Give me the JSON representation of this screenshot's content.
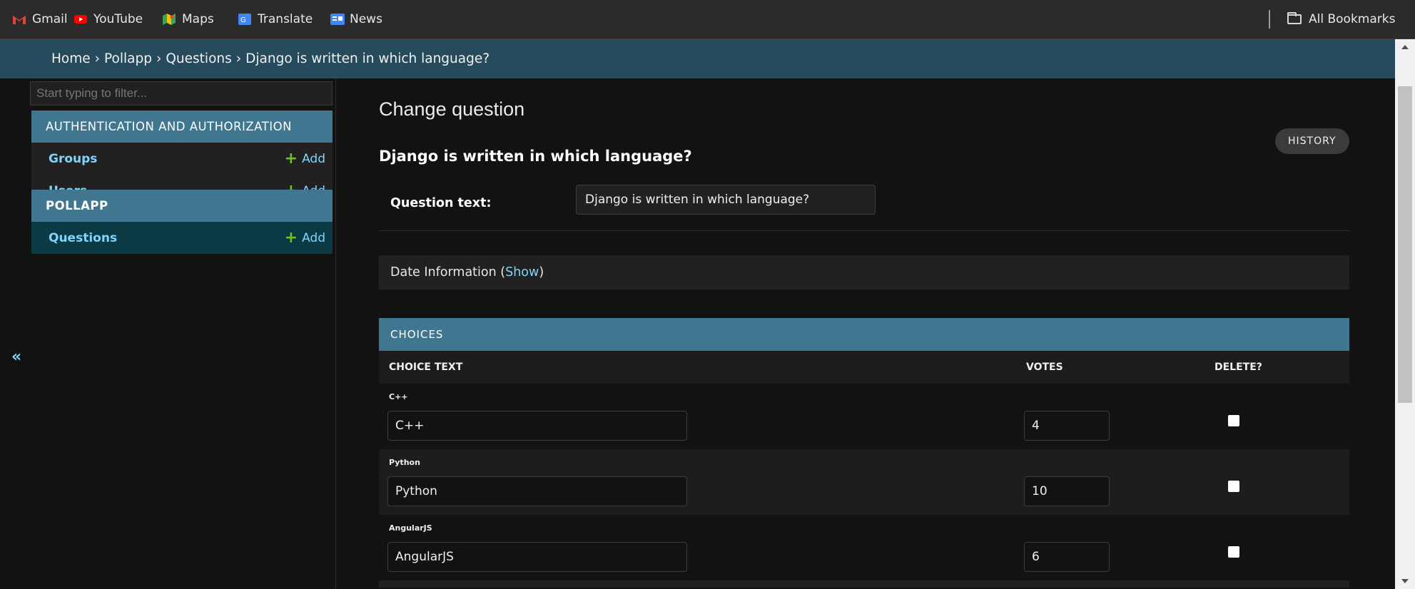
{
  "bookmarks": {
    "items": [
      {
        "label": "Gmail",
        "color": "#ea4335"
      },
      {
        "label": "YouTube",
        "color": "#ff0000"
      },
      {
        "label": "Maps",
        "color": "#34a853"
      },
      {
        "label": "Translate",
        "color": "#4285f4"
      },
      {
        "label": "News",
        "color": "#4285f4"
      }
    ],
    "all_bookmarks": "All Bookmarks"
  },
  "breadcrumb": {
    "home": "Home",
    "app": "Pollapp",
    "model": "Questions",
    "current": "Django is written in which language?",
    "separator": "›"
  },
  "sidebar": {
    "filter_placeholder": "Start typing to filter...",
    "modules": [
      {
        "name": "AUTHENTICATION AND AUTHORIZATION",
        "rows": [
          {
            "label": "Groups",
            "add": "Add"
          },
          {
            "label": "Users",
            "add": "Add"
          }
        ]
      },
      {
        "name": "POLLAPP",
        "rows": [
          {
            "label": "Questions",
            "add": "Add"
          }
        ]
      }
    ],
    "collapse": "«"
  },
  "main": {
    "title": "Change question",
    "history": "HISTORY",
    "object_title": "Django is written in which language?",
    "question_label": "Question text:",
    "question_value": "Django is written in which language?",
    "date_info": "Date Information",
    "date_show": "Show"
  },
  "inline": {
    "title": "CHOICES",
    "col_choice": "CHOICE TEXT",
    "col_votes": "VOTES",
    "col_delete": "DELETE?",
    "rows": [
      {
        "original": "C++",
        "text": "C++",
        "votes": "4"
      },
      {
        "original": "Python",
        "text": "Python",
        "votes": "10"
      },
      {
        "original": "AngularJS",
        "text": "AngularJS",
        "votes": "6"
      }
    ]
  }
}
